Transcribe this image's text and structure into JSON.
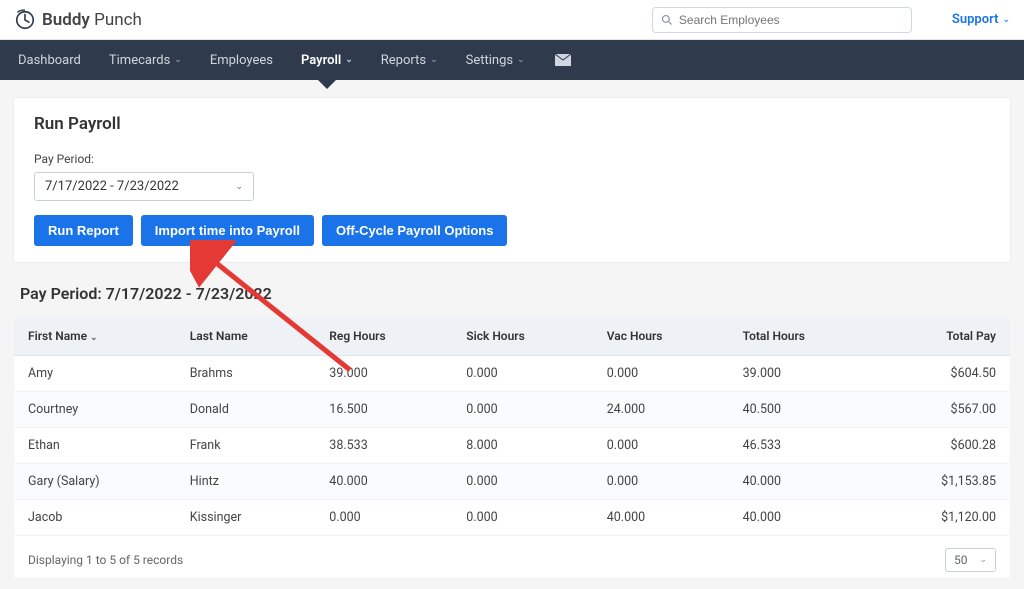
{
  "brand": {
    "name_bold": "Buddy",
    "name_light": " Punch"
  },
  "search": {
    "placeholder": "Search Employees"
  },
  "support": {
    "label": "Support"
  },
  "nav": {
    "items": [
      {
        "label": "Dashboard",
        "has_chevron": false
      },
      {
        "label": "Timecards",
        "has_chevron": true
      },
      {
        "label": "Employees",
        "has_chevron": false
      },
      {
        "label": "Payroll",
        "has_chevron": true,
        "active": true
      },
      {
        "label": "Reports",
        "has_chevron": true
      },
      {
        "label": "Settings",
        "has_chevron": true
      }
    ]
  },
  "run_payroll": {
    "title": "Run Payroll",
    "pay_period_label": "Pay Period:",
    "pay_period_value": "7/17/2022 - 7/23/2022",
    "buttons": {
      "run_report": "Run Report",
      "import_time": "Import time into Payroll",
      "off_cycle": "Off-Cycle Payroll Options"
    }
  },
  "results": {
    "title": "Pay Period: 7/17/2022 - 7/23/2022",
    "columns": {
      "first_name": "First Name",
      "last_name": "Last Name",
      "reg_hours": "Reg Hours",
      "sick_hours": "Sick Hours",
      "vac_hours": "Vac Hours",
      "total_hours": "Total Hours",
      "total_pay": "Total Pay"
    },
    "rows": [
      {
        "first_name": "Amy",
        "last_name": "Brahms",
        "reg_hours": "39.000",
        "sick_hours": "0.000",
        "vac_hours": "0.000",
        "total_hours": "39.000",
        "total_pay": "$604.50"
      },
      {
        "first_name": "Courtney",
        "last_name": "Donald",
        "reg_hours": "16.500",
        "sick_hours": "0.000",
        "vac_hours": "24.000",
        "total_hours": "40.500",
        "total_pay": "$567.00"
      },
      {
        "first_name": "Ethan",
        "last_name": "Frank",
        "reg_hours": "38.533",
        "sick_hours": "8.000",
        "vac_hours": "0.000",
        "total_hours": "46.533",
        "total_pay": "$600.28"
      },
      {
        "first_name": "Gary (Salary)",
        "last_name": "Hintz",
        "reg_hours": "40.000",
        "sick_hours": "0.000",
        "vac_hours": "0.000",
        "total_hours": "40.000",
        "total_pay": "$1,153.85"
      },
      {
        "first_name": "Jacob",
        "last_name": "Kissinger",
        "reg_hours": "0.000",
        "sick_hours": "0.000",
        "vac_hours": "40.000",
        "total_hours": "40.000",
        "total_pay": "$1,120.00"
      }
    ],
    "footer_text": "Displaying 1 to 5 of 5 records",
    "page_size": "50"
  },
  "colors": {
    "nav_bg": "#2f3b4d",
    "primary": "#1a73e8",
    "arrow": "#e53935"
  }
}
